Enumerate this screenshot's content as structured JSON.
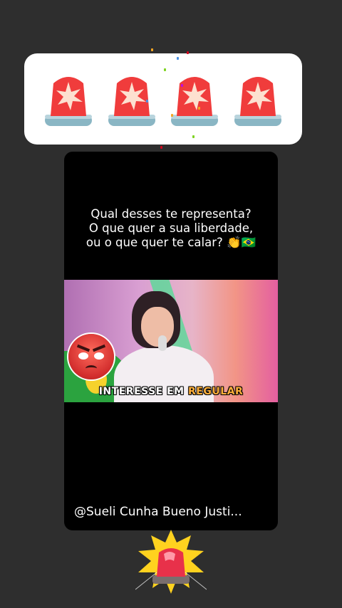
{
  "sticker_bar": {
    "icons": [
      "police-light-icon",
      "police-light-icon",
      "police-light-icon",
      "police-light-icon"
    ],
    "siren_color": "#f03c3c",
    "siren_base_color": "#8ab6c4"
  },
  "post": {
    "caption_lines": [
      "Qual desses te representa?",
      "O que quer a sua liberdade,",
      "ou o que quer te calar? 👏🇧🇷"
    ],
    "video": {
      "subtitle_word1": "INTERESSE EM",
      "subtitle_word2": "REGULAR",
      "sticker_icon": "angry-face-icon"
    },
    "handle": "@Sueli Cunha Bueno Justi..."
  },
  "bottom_sticker": {
    "icon": "police-light-burst-icon",
    "burst_color": "#ffd21f"
  }
}
